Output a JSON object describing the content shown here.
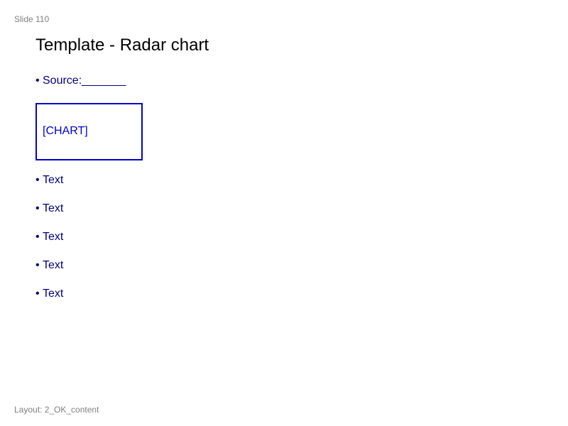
{
  "slide": {
    "number_label": "Slide 110",
    "title": "Template - Radar chart",
    "layout_label": "Layout: 2_OK_content"
  },
  "source": {
    "bullet": "•",
    "text": "Source:_______"
  },
  "chart_placeholder": {
    "label": "[CHART]",
    "border_color": "#0000cc"
  },
  "bullets": [
    {
      "bullet": "•",
      "text": "Text"
    },
    {
      "bullet": "•",
      "text": "Text"
    },
    {
      "bullet": "•",
      "text": "Text"
    },
    {
      "bullet": "•",
      "text": "Text"
    },
    {
      "bullet": "•",
      "text": "Text"
    }
  ],
  "colors": {
    "body_text": "#000080",
    "title_text": "#000000",
    "meta_text": "#808080"
  }
}
